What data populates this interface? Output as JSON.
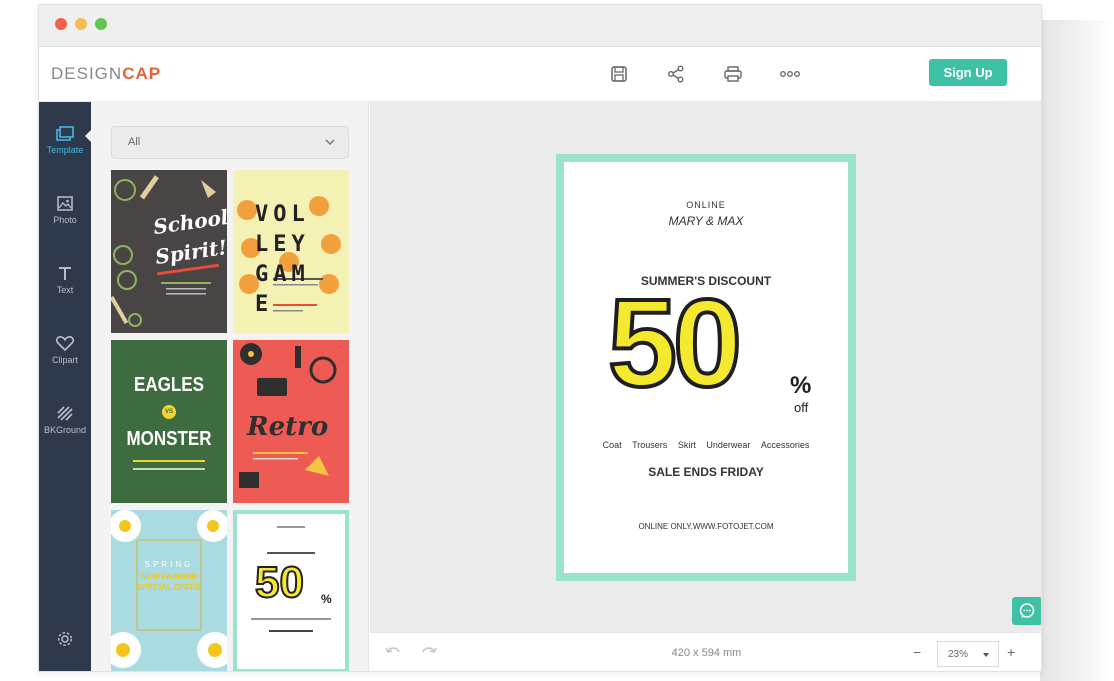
{
  "logo": {
    "design": "DESIGN",
    "cap": "CAP"
  },
  "toolbar": {
    "signup_label": "Sign Up"
  },
  "sidebar": {
    "items": [
      {
        "label": "Template"
      },
      {
        "label": "Photo"
      },
      {
        "label": "Text"
      },
      {
        "label": "Clipart"
      },
      {
        "label": "BKGround"
      }
    ]
  },
  "panel": {
    "category": "All",
    "thumbs": [
      {
        "title_1": "School",
        "title_2": "Spirit!"
      },
      {
        "letters": "VOL LEY GAM E"
      },
      {
        "title_1": "EAGLES",
        "vs": "VS",
        "title_2": "MONSTER"
      },
      {
        "title": "Retro"
      },
      {
        "line1": "SPRING",
        "line2": "NEW FASHION",
        "line3": "SPECIAL OFFER"
      },
      {
        "big": "50",
        "pct": "%"
      }
    ]
  },
  "poster": {
    "online": "ONLINE",
    "brand": "MARY & MAX",
    "headline": "SUMMER'S DISCOUNT",
    "big_number": "50",
    "percent": "%",
    "off": "off",
    "categories": [
      "Coat",
      "Trousers",
      "Skirt",
      "Underwear",
      "Accessories"
    ],
    "sale": "SALE ENDS FRIDAY",
    "footer": "ONLINE ONLY.WWW.FOTOJET.COM"
  },
  "bottom": {
    "dimensions": "420 x 594 mm",
    "zoom": "23%"
  },
  "colors": {
    "accent": "#3fc1a6",
    "sidebar": "#2e3a4b",
    "active": "#3fb8e8",
    "poster_border": "#9be3cc",
    "poster_yellow": "#f5e92f"
  }
}
